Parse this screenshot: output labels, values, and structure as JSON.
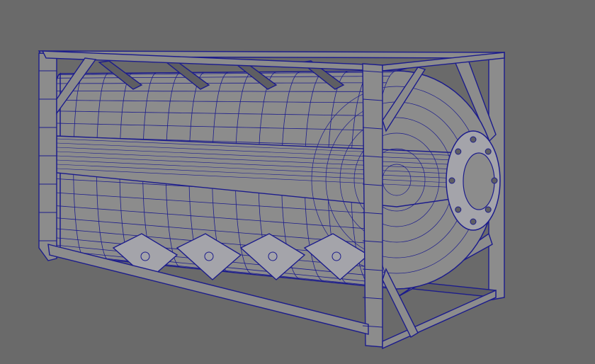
{
  "viewport": {
    "background_color": "#6a6a6a",
    "wire_color": "#1c1c8c",
    "surface_color": "#8c8c8c",
    "surface_light": "#a4a4aa",
    "surface_dark": "#5e5e62"
  }
}
